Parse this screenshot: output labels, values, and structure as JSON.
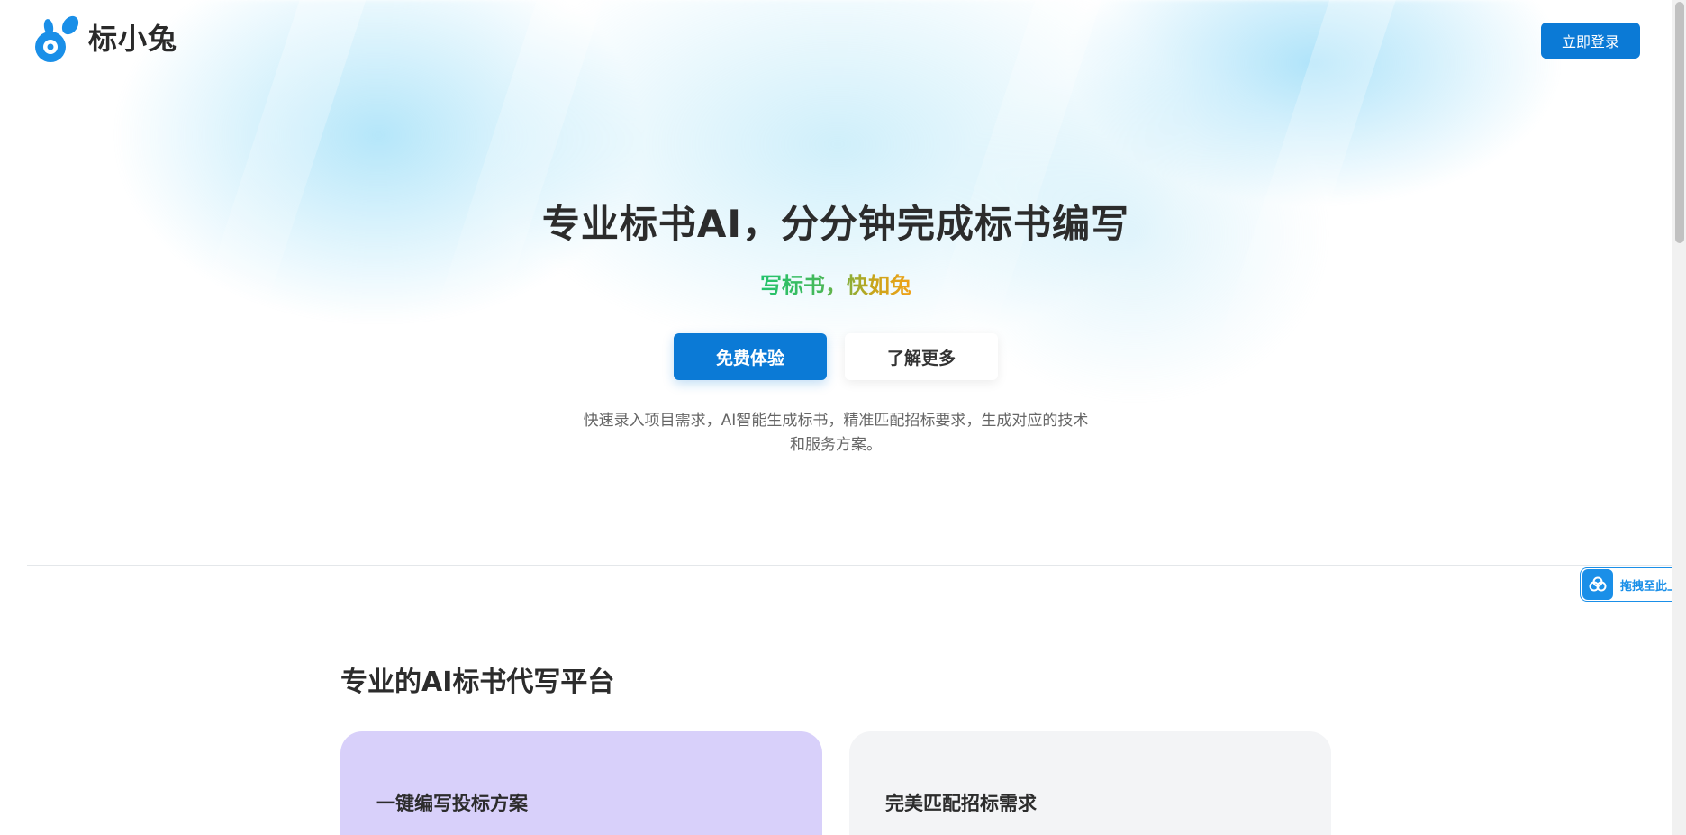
{
  "header": {
    "logo_text": "标小兔",
    "login_label": "立即登录"
  },
  "hero": {
    "title": "专业标书AI，分分钟完成标书编写",
    "slogan": "写标书，快如兔",
    "primary_button": "免费体验",
    "secondary_button": "了解更多",
    "description": "快速录入项目需求，AI智能生成标书，精准匹配招标要求，生成对应的技术和服务方案。"
  },
  "upload_widget": {
    "label": "拖拽至此上传",
    "icon": "cloud-upload-icon"
  },
  "section": {
    "title": "专业的AI标书代写平台",
    "cards": [
      {
        "title": "一键编写投标方案",
        "background": "#d8d0fa"
      },
      {
        "title": "完美匹配招标需求",
        "background": "#f3f4f6"
      }
    ]
  },
  "colors": {
    "primary": "#0b7ad6",
    "slogan_start": "#23c46e",
    "slogan_end": "#f0a21a",
    "text_dark": "#2c2c2c",
    "text_muted": "#666666"
  }
}
